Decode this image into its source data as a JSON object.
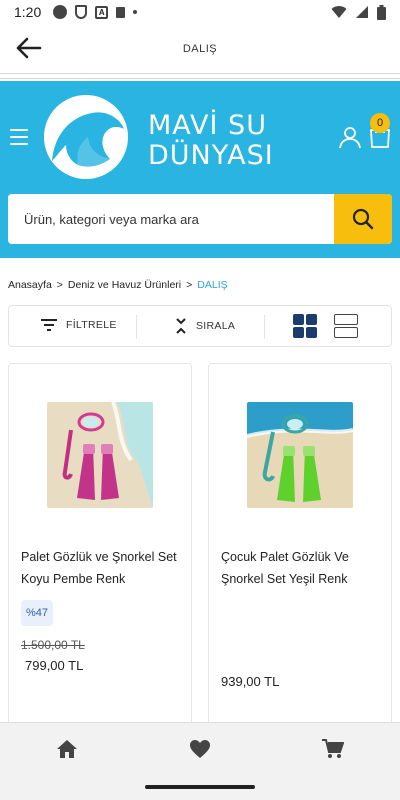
{
  "status_bar": {
    "time": "1:20",
    "icons": [
      "circle-icon",
      "shield-icon",
      "a-icon",
      "sim-icon",
      "dot-icon",
      "wifi-icon",
      "signal-icon",
      "battery-icon"
    ]
  },
  "top_nav": {
    "title": "DALIŞ",
    "back_icon": "arrow-left-icon"
  },
  "header": {
    "brand_line1": "MAVİ SU",
    "brand_line2": "DÜNYASI",
    "cart_count": "0",
    "menu_icon": "hamburger-icon",
    "user_icon": "user-icon",
    "cart_icon": "shopping-bag-icon",
    "accent_color": "#29b4e1",
    "yellow_color": "#f7be0d"
  },
  "search": {
    "placeholder": "Ürün, kategori veya marka ara",
    "icon": "search-icon"
  },
  "breadcrumb": {
    "items": [
      "Anasayfa",
      "Deniz ve Havuz Ürünleri",
      "DALIŞ"
    ],
    "separator": ">"
  },
  "toolbar": {
    "filter_label": "FİLTRELE",
    "sort_label": "SIRALA",
    "grid_icon": "grid-view-icon",
    "list_icon": "list-view-icon"
  },
  "products": [
    {
      "title": "Palet Gözlük ve Şnorkel Set Koyu Pembe Renk",
      "discount": "%47",
      "old_price": "1.500,00 TL",
      "price": "799,00 TL",
      "image_color": "#c2348a"
    },
    {
      "title": "Çocuk Palet Gözlük Ve Şnorkel Set Yeşil Renk",
      "price": "939,00 TL",
      "image_color": "#5fd12c"
    }
  ],
  "bottom_tabs": [
    {
      "name": "home",
      "icon": "home-icon"
    },
    {
      "name": "favorites",
      "icon": "heart-icon"
    },
    {
      "name": "cart",
      "icon": "cart-icon"
    }
  ]
}
